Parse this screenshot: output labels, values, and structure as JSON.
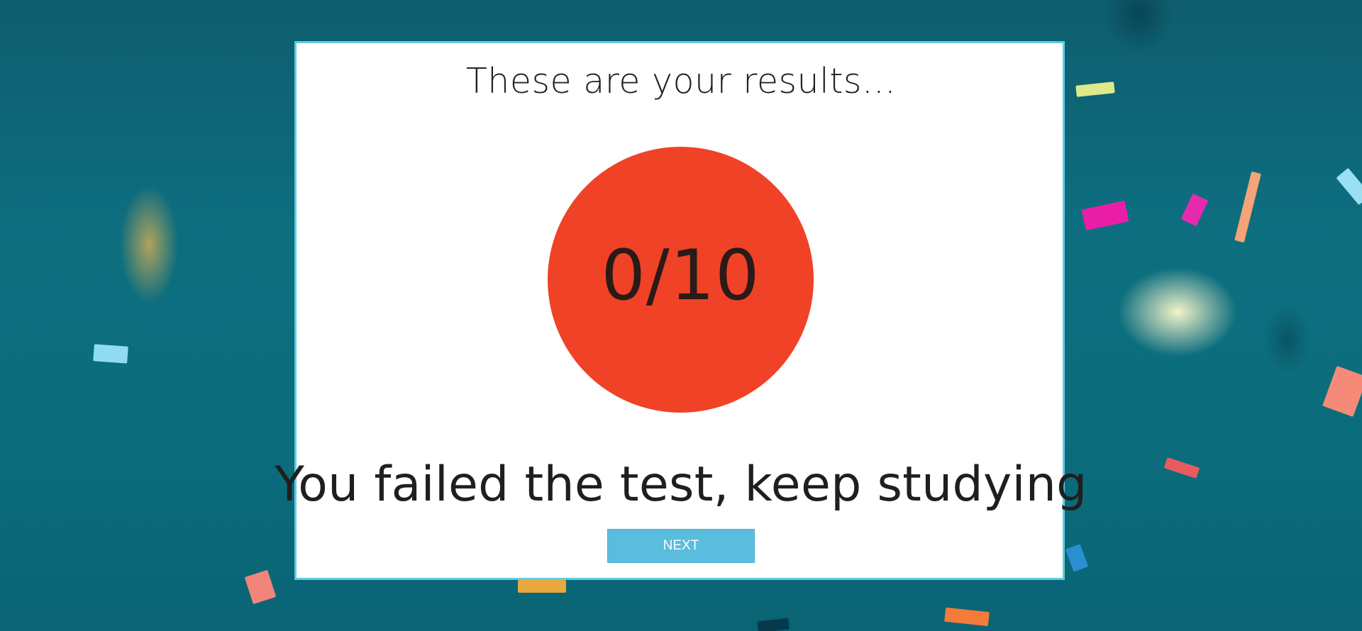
{
  "results": {
    "heading": "These are your results...",
    "score": "0/10",
    "message": "You failed the test, keep studying",
    "next_label": "NEXT"
  },
  "colors": {
    "score_circle": "#f04227",
    "card_border": "#5fcde2",
    "button": "#5bbddd",
    "background": "#0d6e7f"
  }
}
